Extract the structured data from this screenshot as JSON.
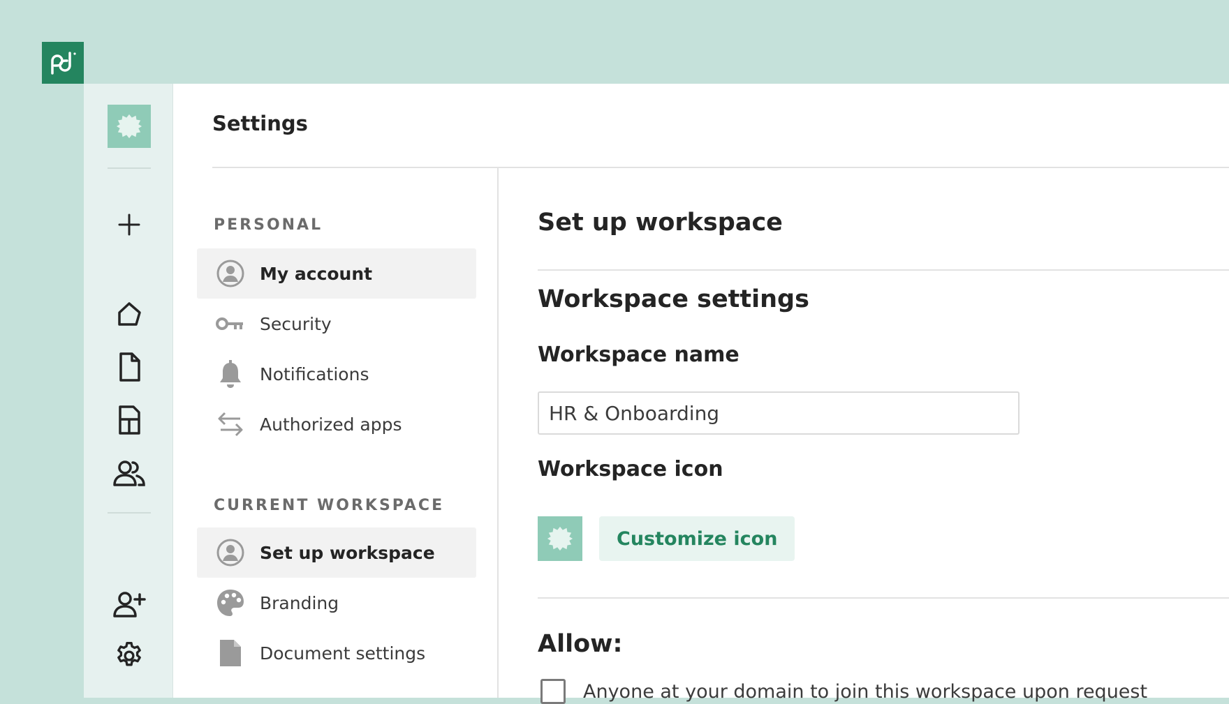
{
  "brand": {
    "logo": "pandadoc-logo",
    "accent": "#24855f",
    "workspace_color": "#8fcbb7"
  },
  "rail": {
    "items": [
      {
        "icon": "plus-icon"
      },
      {
        "icon": "home-icon"
      },
      {
        "icon": "document-icon"
      },
      {
        "icon": "template-icon"
      },
      {
        "icon": "contacts-icon"
      },
      {
        "icon": "add-user-icon"
      },
      {
        "icon": "gear-icon"
      }
    ]
  },
  "header": {
    "title": "Settings"
  },
  "nav": {
    "personal": {
      "label": "PERSONAL",
      "items": [
        {
          "label": "My account",
          "icon": "user-circle-icon",
          "active": true
        },
        {
          "label": "Security",
          "icon": "key-icon"
        },
        {
          "label": "Notifications",
          "icon": "bell-icon"
        },
        {
          "label": "Authorized apps",
          "icon": "arrows-swap-icon"
        }
      ]
    },
    "workspace": {
      "label": "CURRENT WORKSPACE",
      "items": [
        {
          "label": "Set up workspace",
          "icon": "user-circle-icon",
          "active": true
        },
        {
          "label": "Branding",
          "icon": "palette-icon"
        },
        {
          "label": "Document settings",
          "icon": "file-icon"
        }
      ]
    }
  },
  "content": {
    "title": "Set up workspace",
    "section_title": "Workspace settings",
    "name_label": "Workspace name",
    "name_value": "HR & Onboarding",
    "icon_label": "Workspace icon",
    "customize_label": "Customize icon",
    "allow_label": "Allow:",
    "allow_option": "Anyone at your domain to join this workspace upon request",
    "allow_checked": false
  }
}
